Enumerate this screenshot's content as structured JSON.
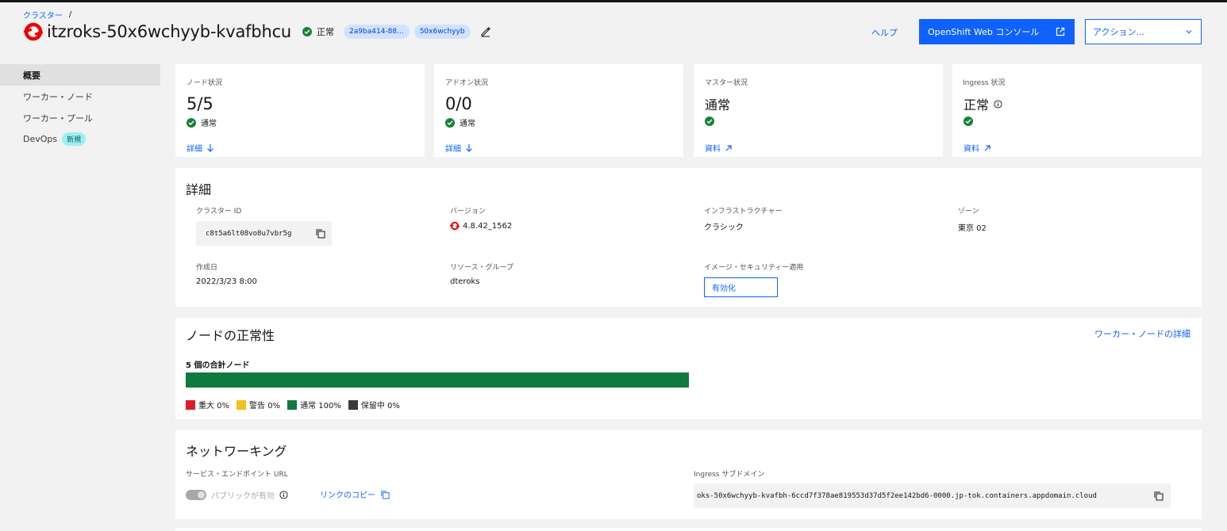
{
  "header": {
    "breadcrumb": {
      "root": "クラスター",
      "separator": "/"
    },
    "cluster_name": "itzroks-50x6wchyyb-kvafbhcu",
    "status": "正常",
    "tags": [
      "2a9ba414-88...",
      "50x6wchyyb"
    ],
    "help": "ヘルプ",
    "console_button": "OpenShift Web コンソール",
    "actions_button": "アクション..."
  },
  "sidebar": {
    "items": [
      {
        "label": "概要"
      },
      {
        "label": "ワーカー・ノード"
      },
      {
        "label": "ワーカー・プール"
      },
      {
        "label": "DevOps",
        "badge": "新規"
      }
    ]
  },
  "stats": [
    {
      "label": "ノード状況",
      "value": "5/5",
      "sub": "通常",
      "link": "詳細"
    },
    {
      "label": "アドオン状況",
      "value": "0/0",
      "sub": "通常",
      "link": "詳細"
    },
    {
      "label": "マスター状況",
      "value": "通常",
      "link": "資料"
    },
    {
      "label": "Ingress 状況",
      "value": "正常",
      "link": "資料"
    }
  ],
  "details": {
    "title": "詳細",
    "cluster_id_label": "クラスター ID",
    "cluster_id": "c8t5a6lt08vo8u7vbr5g",
    "version_label": "バージョン",
    "version": "4.8.42_1562",
    "infra_label": "インフラストラクチャー",
    "infra": "クラシック",
    "zone_label": "ゾーン",
    "zone": "東京 02",
    "created_label": "作成日",
    "created": "2022/3/23 8:00",
    "rg_label": "リソース・グループ",
    "rg": "dteroks",
    "img_sec_label": "イメージ・セキュリティー適用",
    "img_sec_button": "有効化"
  },
  "node_health": {
    "title": "ノードの正常性",
    "link": "ワーカー・ノードの詳細",
    "total": "5 個の合計ノード",
    "legend": [
      {
        "label": "重大 0%",
        "color": "#da1e28"
      },
      {
        "label": "警告 0%",
        "color": "#f1c21b"
      },
      {
        "label": "通常 100%",
        "color": "#0e7a3d"
      },
      {
        "label": "保留中 0%",
        "color": "#393939"
      }
    ],
    "normal_fraction": 1.0
  },
  "networking": {
    "title": "ネットワーキング",
    "endpoint_label": "サービス・エンドポイント URL",
    "public_toggle": "パブリックが有効",
    "copy_link": "リンクのコピー",
    "ingress_label": "Ingress サブドメイン",
    "ingress_value": "oks-50x6wchyyb-kvafbh-6ccd7f378ae819553d37d5f2ee142bd6-0000.jp-tok.containers.appdomain.cloud"
  },
  "colors": {
    "primary": "#0f62fe",
    "success": "#198038",
    "redhat": "#ee0000"
  }
}
